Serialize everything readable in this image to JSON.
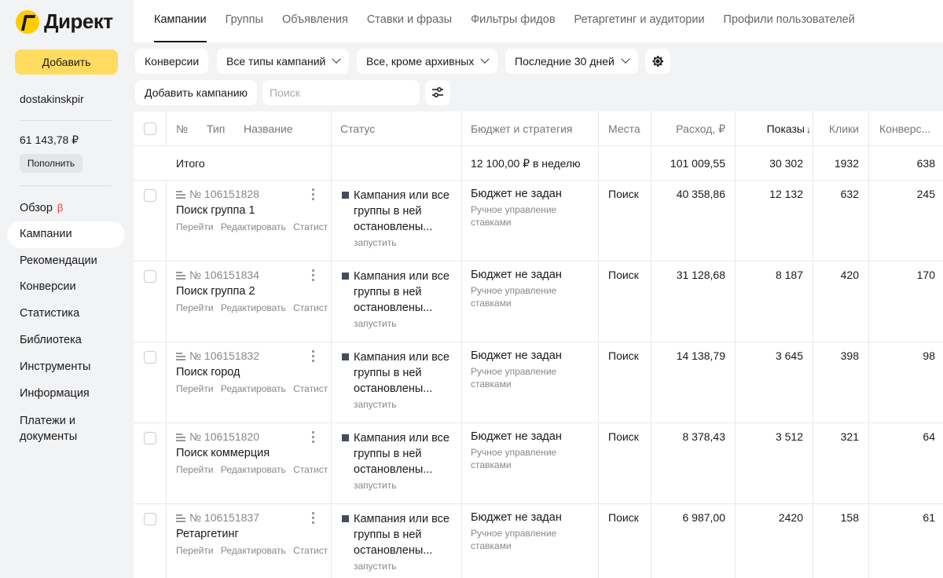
{
  "app": {
    "logo_text": "Директ"
  },
  "sidebar": {
    "add_label": "Добавить",
    "login": "dostakinskpir",
    "balance": "61 143,78 ₽",
    "topup_label": "Пополнить",
    "nav": [
      {
        "label": "Обзор",
        "badge": "β"
      },
      {
        "label": "Кампании",
        "active": true
      },
      {
        "label": "Рекомендации"
      },
      {
        "label": "Конверсии"
      },
      {
        "label": "Статистика"
      },
      {
        "label": "Библиотека"
      },
      {
        "label": "Инструменты"
      },
      {
        "label": "Информация"
      },
      {
        "label": "Платежи и",
        "label2": "документы"
      }
    ]
  },
  "tabs": [
    {
      "label": "Кампании",
      "active": true
    },
    {
      "label": "Группы"
    },
    {
      "label": "Объявления"
    },
    {
      "label": "Ставки и фразы"
    },
    {
      "label": "Фильтры фидов"
    },
    {
      "label": "Ретаргетинг и аудитории"
    },
    {
      "label": "Профили пользователей"
    }
  ],
  "filters": {
    "conversions": "Конверсии",
    "campaign_types": "Все типы кампаний",
    "archive": "Все, кроме архивных",
    "period": "Последние 30 дней",
    "add_campaign": "Добавить кампанию",
    "search_placeholder": "Поиск"
  },
  "table": {
    "headers": {
      "num": "№",
      "type": "Тип",
      "name": "Название",
      "status": "Статус",
      "budget": "Бюджет и стратегия",
      "places": "Места",
      "spend": "Расход, ₽",
      "impressions": "Показы",
      "sort_arrow": "↓",
      "clicks": "Клики",
      "conversions": "Конверс..."
    },
    "total": {
      "label": "Итого",
      "budget": "12 100,00 ₽ в неделю",
      "spend": "101 009,55",
      "impressions": "30 302",
      "clicks": "1932",
      "conversions": "638"
    },
    "row_actions": {
      "go": "Перейти",
      "edit": "Редактировать",
      "stats": "Статист"
    },
    "status_text": [
      "Кампания или все",
      "группы в ней",
      "остановлены..."
    ],
    "start_label": "запустить",
    "budget_text": "Бюджет не задан",
    "strategy_text": [
      "Ручное управление",
      "ставками"
    ],
    "rows": [
      {
        "id": "№ 106151828",
        "name": "Поиск группа 1",
        "places": "Поиск",
        "spend": "40 358,86",
        "impressions": "12 132",
        "clicks": "632",
        "conversions": "245"
      },
      {
        "id": "№ 106151834",
        "name": "Поиск группа 2",
        "places": "Поиск",
        "spend": "31 128,68",
        "impressions": "8 187",
        "clicks": "420",
        "conversions": "170"
      },
      {
        "id": "№ 106151832",
        "name": "Поиск город",
        "places": "Поиск",
        "spend": "14 138,79",
        "impressions": "3 645",
        "clicks": "398",
        "conversions": "98"
      },
      {
        "id": "№ 106151820",
        "name": "Поиск коммерция",
        "places": "Поиск",
        "spend": "8 378,43",
        "impressions": "3 512",
        "clicks": "321",
        "conversions": "64"
      },
      {
        "id": "№ 106151837",
        "name": "Ретаргетинг",
        "places": "Поиск",
        "spend": "6 987,00",
        "impressions": "2420",
        "clicks": "158",
        "conversions": "61"
      }
    ]
  }
}
